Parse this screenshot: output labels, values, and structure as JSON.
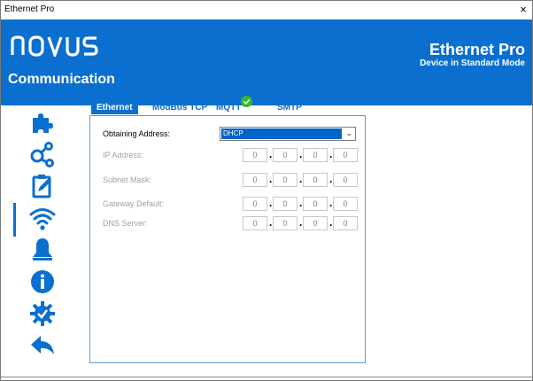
{
  "window": {
    "title": "Ethernet Pro",
    "close": "×"
  },
  "header": {
    "brand": "NOVUS",
    "section": "Communication",
    "product": "Ethernet Pro",
    "mode": "Device in Standard Mode",
    "bg_color": "#0b6fd0"
  },
  "sidebar": {
    "icon_color": "#0b6fd0",
    "items": [
      {
        "icon": "puzzle-icon",
        "label": ""
      },
      {
        "icon": "share-nodes-icon",
        "label": ""
      },
      {
        "icon": "clipboard-edit-icon",
        "label": ""
      },
      {
        "icon": "wifi-icon",
        "label": "",
        "active": true
      },
      {
        "icon": "bell-icon",
        "label": ""
      },
      {
        "icon": "info-icon",
        "label": ""
      },
      {
        "icon": "gear-check-icon",
        "label": ""
      },
      {
        "icon": "back-arrow-icon",
        "label": ""
      }
    ]
  },
  "tabs": [
    {
      "label": "Ethernet",
      "active": true
    },
    {
      "label": "ModBus TCP",
      "active": false
    },
    {
      "label": "MQTT",
      "active": false,
      "badge": "check-badge-icon"
    },
    {
      "label": "SMTP",
      "active": false
    }
  ],
  "form": {
    "obtaining_address": {
      "label": "Obtaining Address:",
      "value": "DHCP"
    },
    "ip_address": {
      "label": "IP Address:",
      "octets": [
        "0",
        "0",
        "0",
        "0"
      ]
    },
    "subnet_mask": {
      "label": "Subnet Mask:",
      "octets": [
        "0",
        "0",
        "0",
        "0"
      ]
    },
    "gateway_default": {
      "label": "Gateway Default:",
      "octets": [
        "0",
        "0",
        "0",
        "0"
      ]
    },
    "dns_server": {
      "label": "DNS Server:",
      "octets": [
        "0",
        "0",
        "0",
        "0"
      ]
    }
  }
}
